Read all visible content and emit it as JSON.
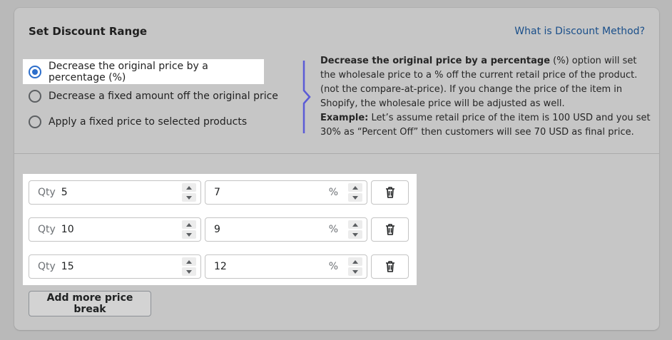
{
  "card": {
    "title": "Set Discount Range",
    "help_link": "What is Discount Method?"
  },
  "options": [
    {
      "label": "Decrease the original price by a percentage (%)",
      "selected": true
    },
    {
      "label": "Decrease a fixed amount off the original price",
      "selected": false
    },
    {
      "label": "Apply a fixed price to selected products",
      "selected": false
    }
  ],
  "description": {
    "bold_lead": "Decrease the original price by a percentage",
    "text_1": " (%) option will set the wholesale price to a % off the current retail price of the product. (not the compare-at-price). If you change the price of the item in Shopify, the wholesale price will be adjusted as well.",
    "example_label": "Example:",
    "example_text": " Let’s assume retail price of the item is 100 USD and you set 30% as “Percent Off” then customers will see 70 USD as final price."
  },
  "price_breaks": {
    "qty_prefix": "Qty",
    "value_suffix": "%",
    "rows": [
      {
        "qty": "5",
        "value": "7"
      },
      {
        "qty": "10",
        "value": "9"
      },
      {
        "qty": "15",
        "value": "12"
      }
    ]
  },
  "add_button": "Add more price break",
  "icons": {
    "radio": "radio-icon",
    "step_up": "chevron-up-icon",
    "step_down": "chevron-down-icon",
    "delete": "trash-icon"
  },
  "colors": {
    "accent": "#2c6ecb",
    "link": "#1a4f8a",
    "bracket": "#5b5bd6"
  }
}
